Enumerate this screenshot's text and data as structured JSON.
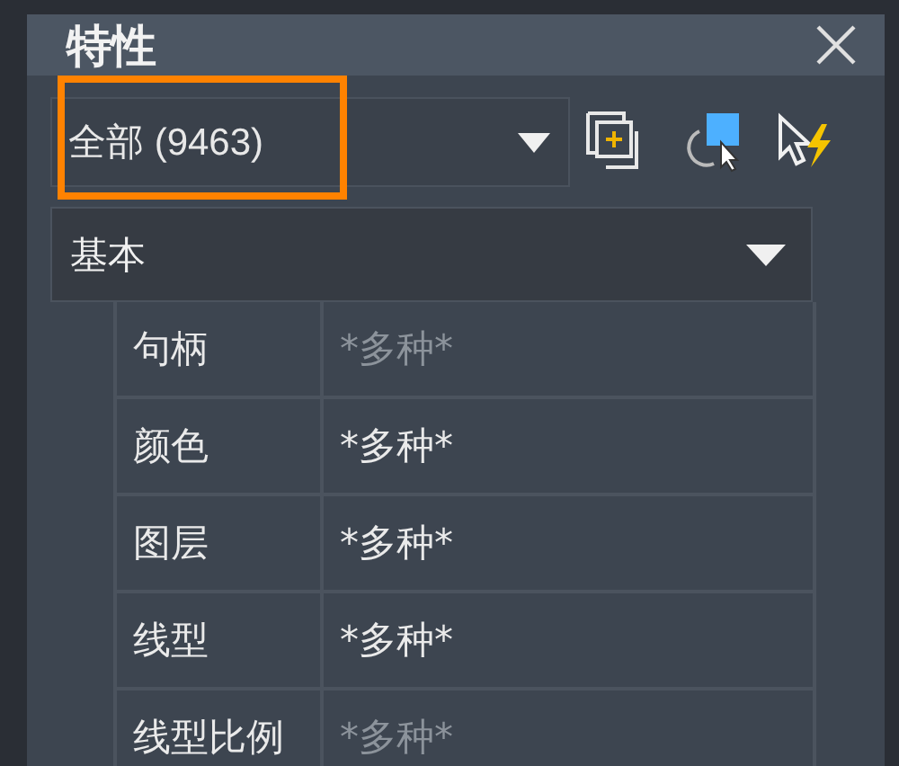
{
  "panel": {
    "title": "特性"
  },
  "selector": {
    "value": "全部 (9463)",
    "highlighted": true
  },
  "section": {
    "label": "基本",
    "expanded": true
  },
  "rows": [
    {
      "label": "句柄",
      "value": "*多种*",
      "disabled": true
    },
    {
      "label": "颜色",
      "value": "*多种*",
      "disabled": false
    },
    {
      "label": "图层",
      "value": "*多种*",
      "disabled": false
    },
    {
      "label": "线型",
      "value": "*多种*",
      "disabled": false
    },
    {
      "label": "线型比例",
      "value": "*多种*",
      "disabled": true
    }
  ]
}
